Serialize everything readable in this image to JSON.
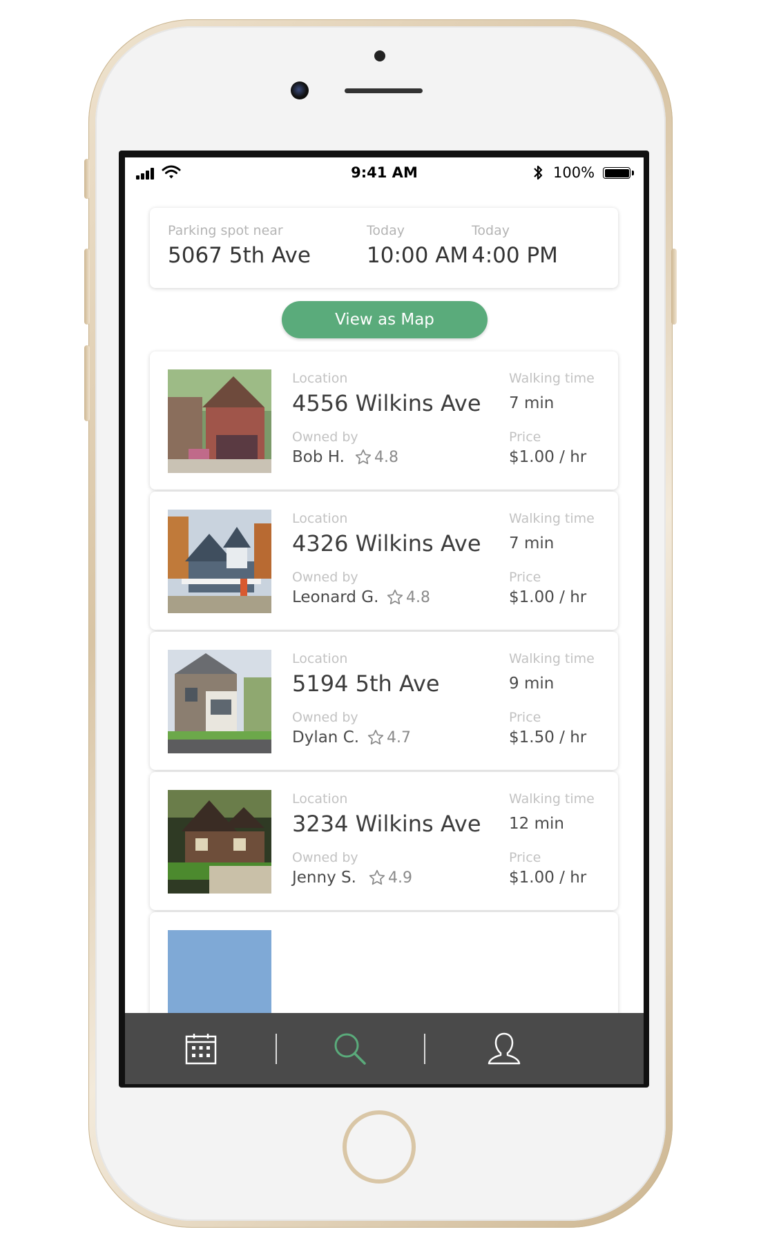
{
  "status_bar": {
    "time": "9:41 AM",
    "battery": "100%"
  },
  "search": {
    "location_label": "Parking spot near",
    "location_value": "5067 5th Ave",
    "start_label": "Today",
    "start_value": "10:00 AM",
    "end_label": "Today",
    "end_value": "4:00 PM"
  },
  "view_map_label": "View as Map",
  "labels": {
    "location": "Location",
    "owned_by": "Owned by",
    "walking_time": "Walking time",
    "price": "Price"
  },
  "listings": [
    {
      "location": "4556 Wilkins Ave",
      "owner": "Bob H.",
      "rating": "4.8",
      "walk": "7 min",
      "price": "$1.00 / hr"
    },
    {
      "location": "4326 Wilkins Ave",
      "owner": "Leonard G.",
      "rating": "4.8",
      "walk": "7 min",
      "price": "$1.00 / hr"
    },
    {
      "location": "5194 5th Ave",
      "owner": "Dylan C.",
      "rating": "4.7",
      "walk": "9 min",
      "price": "$1.50 / hr"
    },
    {
      "location": "3234 Wilkins Ave",
      "owner": "Jenny S.",
      "rating": "4.9",
      "walk": "12 min",
      "price": "$1.00 / hr"
    }
  ],
  "tabs": [
    {
      "icon": "calendar-icon"
    },
    {
      "icon": "search-icon",
      "active": true
    },
    {
      "icon": "profile-icon"
    }
  ],
  "colors": {
    "accent": "#5aab7b",
    "tab_bar": "#4a4a4a",
    "label": "#b4b4b4"
  }
}
